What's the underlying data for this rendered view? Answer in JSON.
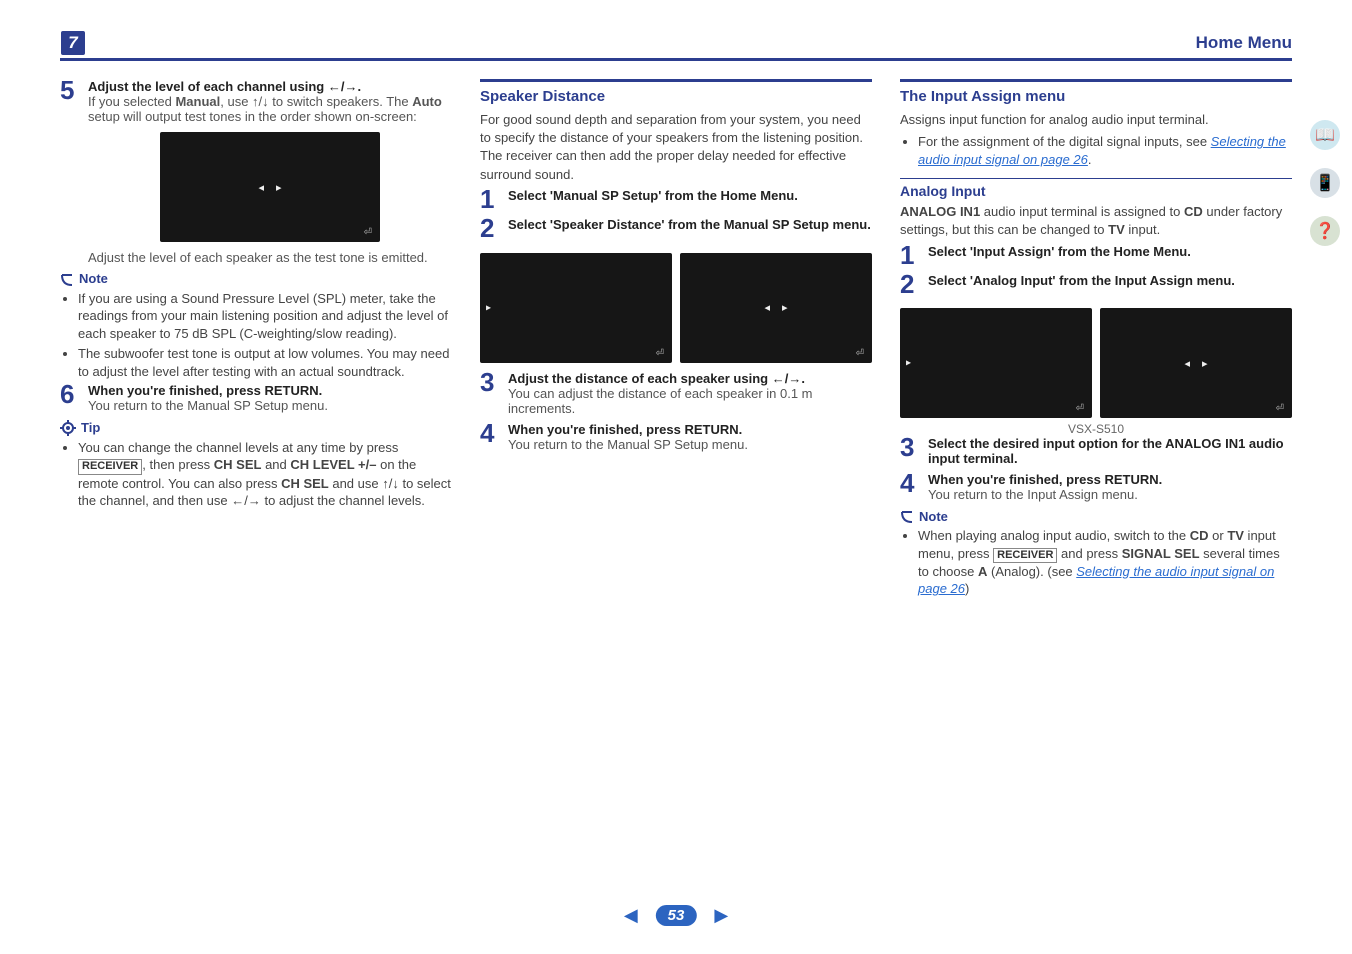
{
  "chapter_number": "7",
  "header_title": "Home Menu",
  "page_number": "53",
  "col1": {
    "step5": {
      "num": "5",
      "title_a": "Adjust the level of each channel using ",
      "title_b": "/",
      "title_c": ".",
      "desc_a": "If you selected ",
      "manual": "Manual",
      "desc_b": ", use ",
      "desc_c": "/",
      "desc_d": " to switch speakers. The ",
      "auto": "Auto",
      "desc_e": " setup will output test tones in the order shown on-screen:",
      "after": "Adjust the level of each speaker as the test tone is emitted."
    },
    "note_label": "Note",
    "note_items": [
      "If you are using a Sound Pressure Level (SPL) meter, take the readings from your main listening position and adjust the level of each speaker to 75 dB SPL (C-weighting/slow reading).",
      "The subwoofer test tone is output at low volumes. You may need to adjust the level after testing with an actual soundtrack."
    ],
    "step6": {
      "num": "6",
      "title_a": "When you're finished, press ",
      "return": "RETURN",
      "title_b": ".",
      "desc": "You return to the Manual SP Setup menu."
    },
    "tip_label": "Tip",
    "tip_a": "You can change the channel levels at any time by press ",
    "receiver": "RECEIVER",
    "tip_b": ", then press ",
    "chsel": "CH SEL",
    "tip_c": " and ",
    "chlevel": "CH LEVEL +/–",
    "tip_d": " on the remote control. You can also press ",
    "tip_e": " and use ",
    "tip_f": "/",
    "tip_g": " to select the channel, and then use ",
    "tip_h": "/",
    "tip_i": " to adjust the channel levels."
  },
  "col2": {
    "title": "Speaker Distance",
    "intro": "For good sound depth and separation from your system, you need to specify the distance of your speakers from the listening position. The receiver can then add the proper delay needed for effective surround sound.",
    "step1": {
      "num": "1",
      "title": "Select 'Manual SP Setup' from the Home Menu."
    },
    "step2": {
      "num": "2",
      "title": "Select 'Speaker Distance' from the Manual SP Setup menu."
    },
    "step3": {
      "num": "3",
      "title_a": "Adjust the distance of each speaker using ",
      "title_b": "/",
      "title_c": ".",
      "desc": "You can adjust the distance of each speaker in 0.1 m increments."
    },
    "step4": {
      "num": "4",
      "title_a": "When you're finished, press ",
      "return": "RETURN",
      "title_b": ".",
      "desc": "You return to the Manual SP Setup menu."
    }
  },
  "col3": {
    "title": "The Input Assign menu",
    "intro": "Assigns input function for analog audio input terminal.",
    "bullet_a": "For the assignment of the digital signal inputs, see ",
    "link1": "Selecting the audio input signal",
    "bullet_b": " on page 26",
    "bullet_c": ".",
    "sub_title": "Analog Input",
    "sub_a": "ANALOG IN1",
    "sub_b": " audio input terminal is assigned to ",
    "sub_cd": "CD",
    "sub_c": " under factory settings, but this can be changed to ",
    "sub_tv": "TV",
    "sub_d": " input.",
    "step1": {
      "num": "1",
      "title": "Select 'Input Assign' from the Home Menu."
    },
    "step2": {
      "num": "2",
      "title": "Select 'Analog Input' from the Input Assign menu."
    },
    "caption": "VSX-S510",
    "step3": {
      "num": "3",
      "title": "Select the desired input option for the ANALOG IN1 audio input terminal."
    },
    "step4": {
      "num": "4",
      "title_a": "When you're finished, press ",
      "return": "RETURN",
      "title_b": ".",
      "desc": "You return to the Input Assign menu."
    },
    "note_label": "Note",
    "note_a": "When playing analog input audio, switch to the ",
    "note_cd": "CD",
    "note_b": " or ",
    "note_tv": "TV",
    "note_c": " input menu, press ",
    "receiver": "RECEIVER",
    "note_d": " and press ",
    "sigsel": "SIGNAL SEL",
    "note_e": " several times to choose ",
    "note_a_opt": "A",
    "note_f": " (Analog). (see ",
    "link2": "Selecting the audio input signal",
    "note_g": " on page 26",
    "note_h": ")"
  }
}
